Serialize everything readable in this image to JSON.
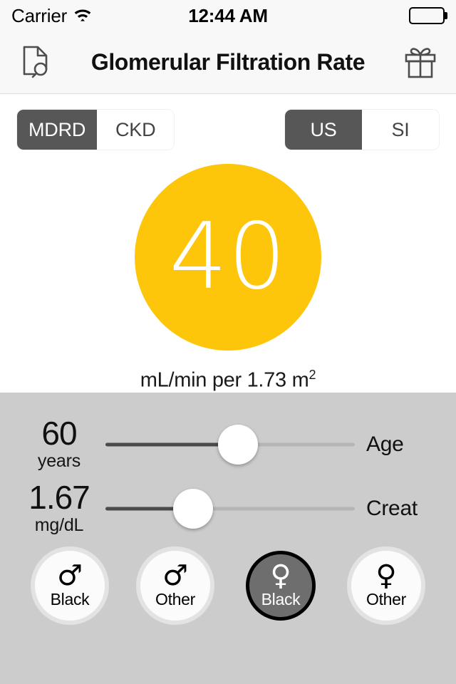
{
  "status_bar": {
    "carrier": "Carrier",
    "wifi_icon": "wifi-icon",
    "time": "12:44 AM",
    "battery_icon": "battery-full-icon"
  },
  "nav_bar": {
    "title": "Glomerular Filtration Rate",
    "left_icon": "document-search-icon",
    "right_icon": "gift-icon"
  },
  "formula_segment": {
    "name": "formula-selector",
    "options": [
      "MDRD",
      "CKD"
    ],
    "selected": "MDRD"
  },
  "units_segment": {
    "name": "units-selector",
    "options": [
      "US",
      "SI"
    ],
    "selected": "US"
  },
  "result": {
    "value": "40",
    "units_text": "mL/min per 1.73 m",
    "units_superscript": "2",
    "circle_color": "#FDC60B"
  },
  "sliders": [
    {
      "id": "age",
      "value": "60",
      "unit": "years",
      "label": "Age",
      "percent": 53
    },
    {
      "id": "creat",
      "value": "1.67",
      "unit": "mg/dL",
      "label": "Creat",
      "percent": 35
    }
  ],
  "gender_options": [
    {
      "id": "male-black",
      "symbol": "♂",
      "label": "Black",
      "selected": false
    },
    {
      "id": "male-other",
      "symbol": "♂",
      "label": "Other",
      "selected": false
    },
    {
      "id": "female-black",
      "symbol": "♀",
      "label": "Black",
      "selected": true
    },
    {
      "id": "female-other",
      "symbol": "♀",
      "label": "Other",
      "selected": false
    }
  ]
}
